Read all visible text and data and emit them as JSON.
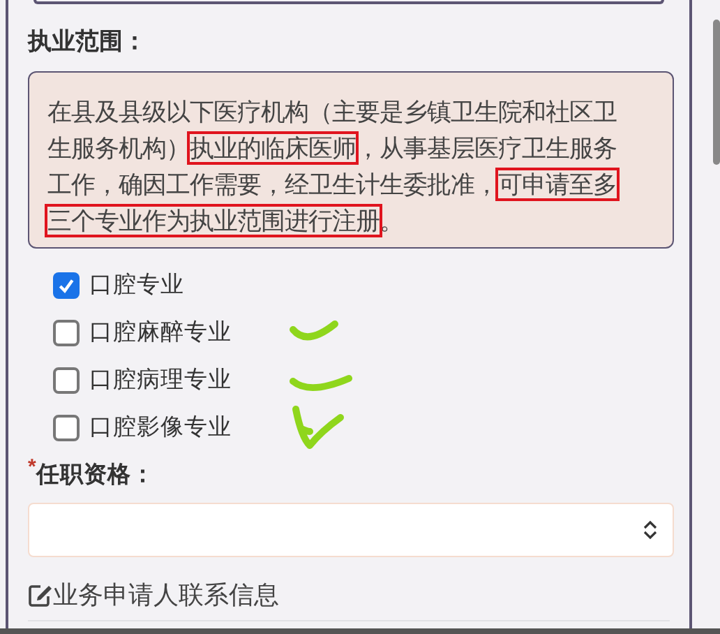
{
  "scope_label": "执业范围：",
  "notice": {
    "segments": [
      {
        "text": "在县及县级以下医疗机构（主要是乡镇卫生院和社区卫生服务机构）",
        "highlighted": false
      },
      {
        "text": "执业的临床医师",
        "highlighted": true
      },
      {
        "text": "，从事基层医疗卫生服务工作，确因工作需要，经卫生计生委批准，",
        "highlighted": false
      },
      {
        "text": "可申请至多三个专业作为执业范围进行注册",
        "highlighted": true
      },
      {
        "text": "。",
        "highlighted": false
      }
    ]
  },
  "options": [
    {
      "label": "口腔专业",
      "checked": true
    },
    {
      "label": "口腔麻醉专业",
      "checked": false
    },
    {
      "label": "口腔病理专业",
      "checked": false
    },
    {
      "label": "口腔影像专业",
      "checked": false
    }
  ],
  "qualification": {
    "label": "任职资格：",
    "required": true,
    "required_mark": "*"
  },
  "contact_section": {
    "title": "业务申请人联系信息"
  }
}
